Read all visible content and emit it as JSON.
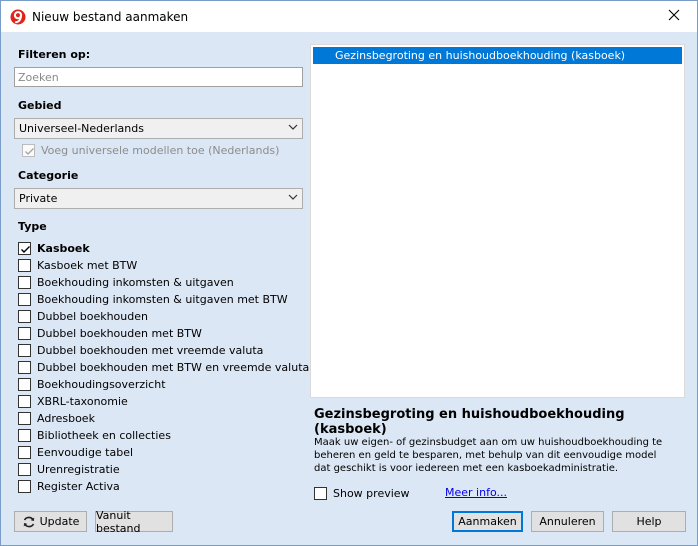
{
  "window": {
    "title": "Nieuw bestand aanmaken"
  },
  "filter": {
    "label": "Filteren op:",
    "search_placeholder": "Zoeken"
  },
  "region": {
    "label": "Gebied",
    "selected": "Universeel-Nederlands",
    "include_universal_label": "Voeg universele modellen toe (Nederlands)"
  },
  "category": {
    "label": "Categorie",
    "selected": "Private"
  },
  "type": {
    "label": "Type",
    "items": [
      {
        "label": "Kasboek",
        "checked": true
      },
      {
        "label": "Kasboek met BTW",
        "checked": false
      },
      {
        "label": "Boekhouding inkomsten & uitgaven",
        "checked": false
      },
      {
        "label": "Boekhouding inkomsten & uitgaven met BTW",
        "checked": false
      },
      {
        "label": "Dubbel boekhouden",
        "checked": false
      },
      {
        "label": "Dubbel boekhouden met BTW",
        "checked": false
      },
      {
        "label": "Dubbel boekhouden met vreemde valuta",
        "checked": false
      },
      {
        "label": "Dubbel boekhouden met BTW en vreemde valuta",
        "checked": false
      },
      {
        "label": "Boekhoudingsoverzicht",
        "checked": false
      },
      {
        "label": "XBRL-taxonomie",
        "checked": false
      },
      {
        "label": "Adresboek",
        "checked": false
      },
      {
        "label": "Bibliotheek en collecties",
        "checked": false
      },
      {
        "label": "Eenvoudige tabel",
        "checked": false
      },
      {
        "label": "Urenregistratie",
        "checked": false
      },
      {
        "label": "Register Activa",
        "checked": false
      }
    ]
  },
  "templates": {
    "items": [
      "Gezinsbegroting en huishoudboekhouding (kasboek)"
    ],
    "selected_index": 0
  },
  "description": {
    "title": "Gezinsbegroting en huishoudboekhouding (kasboek)",
    "text": "Maak uw eigen- of gezinsbudget aan om uw huishoudboekhouding te beheren en geld te besparen, met behulp van dit eenvoudige model dat geschikt is voor iedereen met een kasboekadministratie."
  },
  "preview": {
    "label": "Show preview",
    "checked": false
  },
  "more_info": "Meer info...",
  "buttons": {
    "update": "Update",
    "from_file": "Vanuit bestand",
    "create": "Aanmaken",
    "cancel": "Annuleren",
    "help": "Help"
  },
  "colors": {
    "selection": "#0078d7",
    "background": "#dce7f5",
    "link": "#0000ee"
  },
  "icons": {
    "app": "app-logo-icon",
    "close": "close-icon",
    "chevron": "chevron-down-icon",
    "refresh": "refresh-icon",
    "check": "checkmark-icon"
  }
}
